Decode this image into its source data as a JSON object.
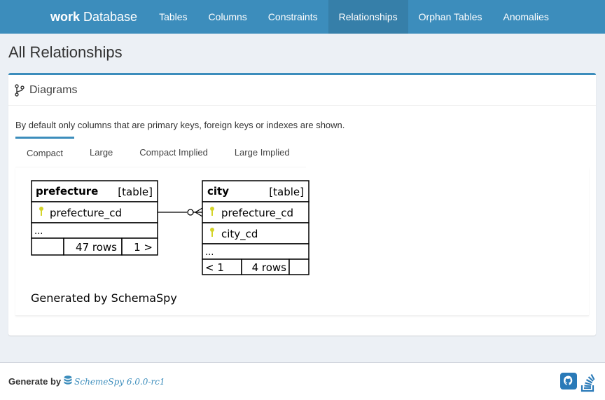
{
  "navbar": {
    "brand_bold": "work",
    "brand_rest": "Database",
    "items": [
      {
        "label": "Tables"
      },
      {
        "label": "Columns"
      },
      {
        "label": "Constraints"
      },
      {
        "label": "Relationships",
        "active": true
      },
      {
        "label": "Orphan Tables"
      },
      {
        "label": "Anomalies"
      }
    ]
  },
  "page_title": "All Relationships",
  "box": {
    "title": "Diagrams",
    "icon": "branch-icon",
    "description": "By default only columns that are primary keys, foreign keys or indexes are shown."
  },
  "tabs": [
    {
      "label": "Compact",
      "active": true
    },
    {
      "label": "Large"
    },
    {
      "label": "Compact Implied"
    },
    {
      "label": "Large Implied"
    }
  ],
  "diagram": {
    "tables": [
      {
        "name": "prefecture",
        "type": "[table]",
        "columns": [
          {
            "name": "prefecture_cd",
            "icon": "key-icon"
          }
        ],
        "more": "...",
        "footer": {
          "left": "",
          "rows": "47 rows",
          "right": "1 >"
        }
      },
      {
        "name": "city",
        "type": "[table]",
        "columns": [
          {
            "name": "prefecture_cd",
            "icon": "key-icon"
          },
          {
            "name": "city_cd",
            "icon": "key-icon"
          }
        ],
        "more": "...",
        "footer": {
          "left": "< 1",
          "rows": "4 rows",
          "right": ""
        }
      }
    ],
    "generated": "Generated by SchemaSpy"
  },
  "footer": {
    "generate_by": "Generate by",
    "product": "SchemeSpy 6.0.0-rc1",
    "icons": [
      "github-icon",
      "stackoverflow-icon"
    ]
  },
  "colors": {
    "navbar": "#3c8dbc",
    "navbar_active": "#367fa9",
    "key": "#d4d42a"
  }
}
